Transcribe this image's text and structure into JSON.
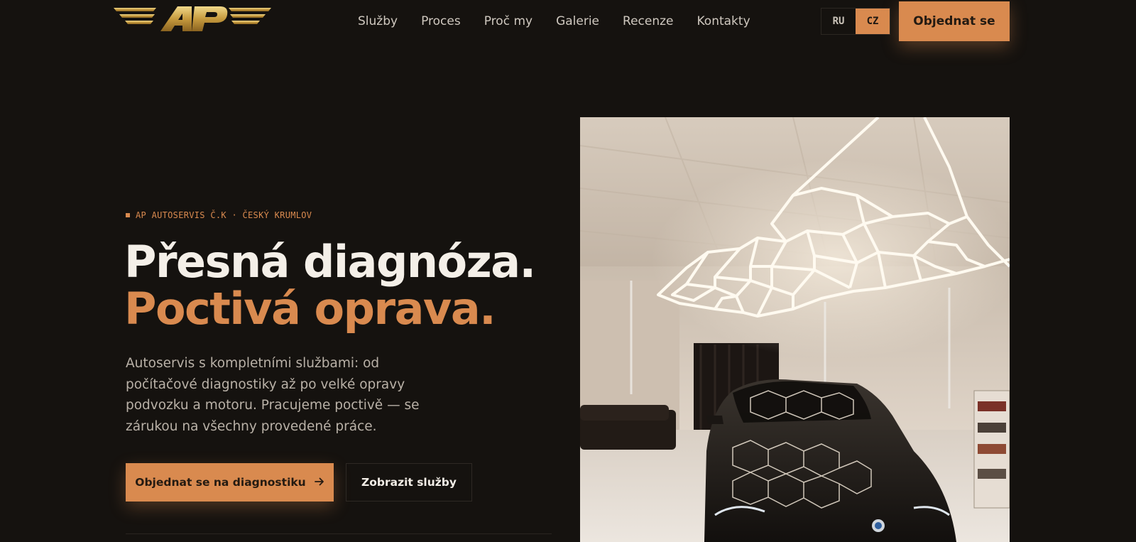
{
  "header": {
    "logo_text": "AP",
    "nav": [
      "Služby",
      "Proces",
      "Proč my",
      "Galerie",
      "Recenze",
      "Kontakty"
    ],
    "languages": [
      {
        "label": "RU",
        "active": false
      },
      {
        "label": "CZ",
        "active": true
      }
    ],
    "order_label": "Objednat se"
  },
  "hero": {
    "eyebrow": "AP AUTOSERVIS Č.K · ČESKÝ KRUMLOV",
    "title_line1": "Přesná diagnóza.",
    "title_line2": "Poctivá oprava.",
    "lead": "Autoservis s kompletními službami: od počítačové diagnostiky až po velké opravy podvozku a motoru. Pracujeme poctivě — se zárukou na všechny provedené práce.",
    "cta_primary": "Objednat se na diagnostiku",
    "cta_primary_icon": "arrow-right-icon",
    "cta_secondary": "Zobrazit služby"
  },
  "colors": {
    "background": "#15120f",
    "accent": "#d98a4f",
    "text": "#f2ede6",
    "muted": "#b9b1a7"
  }
}
